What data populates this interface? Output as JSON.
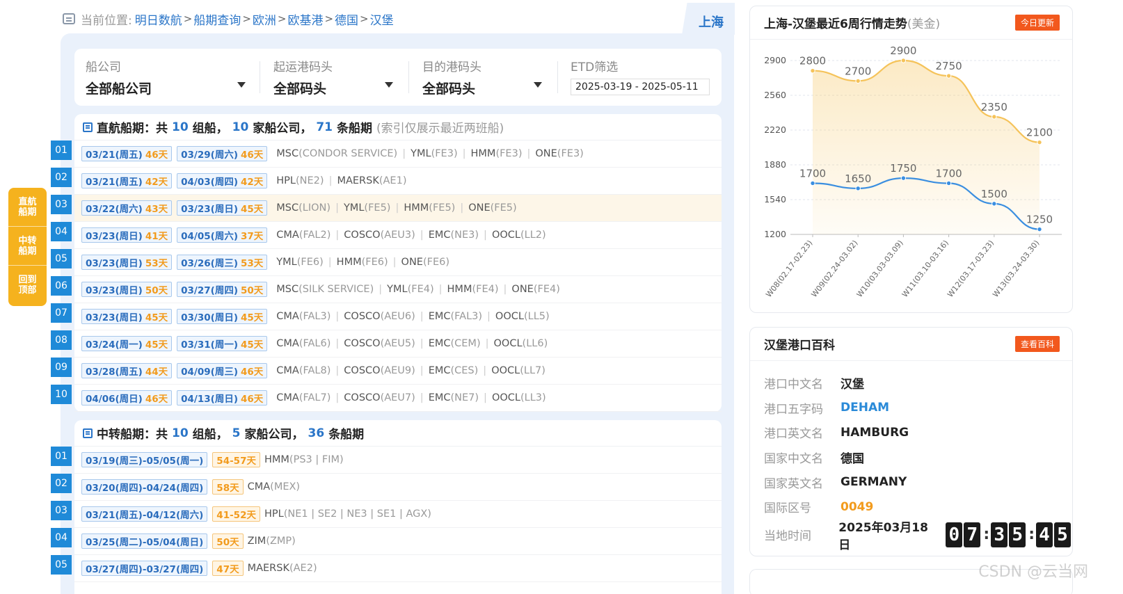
{
  "breadcrumb": {
    "prefix": "当前位置:",
    "items": [
      "明日数航",
      "船期查询",
      "欧洲",
      "欧基港",
      "德国",
      "汉堡"
    ],
    "separator": ">"
  },
  "port_tab": "上海",
  "filters": {
    "carrier": {
      "label": "船公司",
      "value": "全部船公司"
    },
    "origin": {
      "label": "起运港码头",
      "value": "全部码头"
    },
    "destination": {
      "label": "目的港码头",
      "value": "全部码头"
    },
    "etd": {
      "label": "ETD筛选",
      "value": "2025-03-19 - 2025-05-11"
    }
  },
  "direct": {
    "title_prefix": "直航船期：共",
    "groups": "10",
    "groups_unit": "组船，",
    "carriers": "10",
    "carriers_unit": "家船公司，",
    "schedules": "71",
    "schedules_unit": "条船期",
    "note": "(索引仅展示最近两班船)",
    "rows": [
      {
        "num": "01",
        "d1": "03/21(周五)",
        "t1": "46天",
        "d2": "03/29(周六)",
        "t2": "46天",
        "carriers": [
          {
            "name": "MSC",
            "svc": "(CONDOR SERVICE)"
          },
          {
            "name": "YML",
            "svc": "(FE3)"
          },
          {
            "name": "HMM",
            "svc": "(FE3)"
          },
          {
            "name": "ONE",
            "svc": "(FE3)"
          }
        ]
      },
      {
        "num": "02",
        "d1": "03/21(周五)",
        "t1": "42天",
        "d2": "04/03(周四)",
        "t2": "42天",
        "carriers": [
          {
            "name": "HPL",
            "svc": "(NE2)"
          },
          {
            "name": "MAERSK",
            "svc": "(AE1)"
          }
        ]
      },
      {
        "num": "03",
        "d1": "03/22(周六)",
        "t1": "43天",
        "d2": "03/23(周日)",
        "t2": "45天",
        "carriers": [
          {
            "name": "MSC",
            "svc": "(LION)"
          },
          {
            "name": "YML",
            "svc": "(FE5)"
          },
          {
            "name": "HMM",
            "svc": "(FE5)"
          },
          {
            "name": "ONE",
            "svc": "(FE5)"
          }
        ]
      },
      {
        "num": "04",
        "d1": "03/23(周日)",
        "t1": "41天",
        "d2": "04/05(周六)",
        "t2": "37天",
        "carriers": [
          {
            "name": "CMA",
            "svc": "(FAL2)"
          },
          {
            "name": "COSCO",
            "svc": "(AEU3)"
          },
          {
            "name": "EMC",
            "svc": "(NE3)"
          },
          {
            "name": "OOCL",
            "svc": "(LL2)"
          }
        ]
      },
      {
        "num": "05",
        "d1": "03/23(周日)",
        "t1": "53天",
        "d2": "03/26(周三)",
        "t2": "53天",
        "carriers": [
          {
            "name": "YML",
            "svc": "(FE6)"
          },
          {
            "name": "HMM",
            "svc": "(FE6)"
          },
          {
            "name": "ONE",
            "svc": "(FE6)"
          }
        ]
      },
      {
        "num": "06",
        "d1": "03/23(周日)",
        "t1": "50天",
        "d2": "03/27(周四)",
        "t2": "50天",
        "carriers": [
          {
            "name": "MSC",
            "svc": "(SILK SERVICE)"
          },
          {
            "name": "YML",
            "svc": "(FE4)"
          },
          {
            "name": "HMM",
            "svc": "(FE4)"
          },
          {
            "name": "ONE",
            "svc": "(FE4)"
          }
        ]
      },
      {
        "num": "07",
        "d1": "03/23(周日)",
        "t1": "45天",
        "d2": "03/30(周日)",
        "t2": "45天",
        "carriers": [
          {
            "name": "CMA",
            "svc": "(FAL3)"
          },
          {
            "name": "COSCO",
            "svc": "(AEU6)"
          },
          {
            "name": "EMC",
            "svc": "(FAL3)"
          },
          {
            "name": "OOCL",
            "svc": "(LL5)"
          }
        ]
      },
      {
        "num": "08",
        "d1": "03/24(周一)",
        "t1": "45天",
        "d2": "03/31(周一)",
        "t2": "45天",
        "carriers": [
          {
            "name": "CMA",
            "svc": "(FAL6)"
          },
          {
            "name": "COSCO",
            "svc": "(AEU5)"
          },
          {
            "name": "EMC",
            "svc": "(CEM)"
          },
          {
            "name": "OOCL",
            "svc": "(LL6)"
          }
        ]
      },
      {
        "num": "09",
        "d1": "03/28(周五)",
        "t1": "44天",
        "d2": "04/09(周三)",
        "t2": "46天",
        "carriers": [
          {
            "name": "CMA",
            "svc": "(FAL8)"
          },
          {
            "name": "COSCO",
            "svc": "(AEU9)"
          },
          {
            "name": "EMC",
            "svc": "(CES)"
          },
          {
            "name": "OOCL",
            "svc": "(LL7)"
          }
        ]
      },
      {
        "num": "10",
        "d1": "04/06(周日)",
        "t1": "46天",
        "d2": "04/13(周日)",
        "t2": "46天",
        "carriers": [
          {
            "name": "CMA",
            "svc": "(FAL7)"
          },
          {
            "name": "COSCO",
            "svc": "(AEU7)"
          },
          {
            "name": "EMC",
            "svc": "(NE7)"
          },
          {
            "name": "OOCL",
            "svc": "(LL3)"
          }
        ]
      }
    ]
  },
  "transfer": {
    "title_prefix": "中转船期：共",
    "groups": "10",
    "groups_unit": "组船，",
    "carriers": "5",
    "carriers_unit": "家船公司，",
    "schedules": "36",
    "schedules_unit": "条船期",
    "rows": [
      {
        "num": "01",
        "range": "03/19(周三)-05/05(周一)",
        "days": "54-57天",
        "carrier": "HMM",
        "svc": "(PS3 | FIM)"
      },
      {
        "num": "02",
        "range": "03/20(周四)-04/24(周四)",
        "days": "58天",
        "carrier": "CMA",
        "svc": "(MEX)"
      },
      {
        "num": "03",
        "range": "03/21(周五)-04/12(周六)",
        "days": "41-52天",
        "carrier": "HPL",
        "svc": "(NE1 | SE2 | NE3 | SE1 | AGX)"
      },
      {
        "num": "04",
        "range": "03/25(周二)-05/04(周日)",
        "days": "50天",
        "carrier": "ZIM",
        "svc": "(ZMP)"
      },
      {
        "num": "05",
        "range": "03/27(周四)-03/27(周四)",
        "days": "47天",
        "carrier": "MAERSK",
        "svc": "(AE2)"
      }
    ]
  },
  "side_nav": [
    "直航船期",
    "中转船期",
    "回到顶部"
  ],
  "trend_card": {
    "title": "上海-汉堡最近6周行情走势",
    "unit": "(美金)",
    "badge": "今日更新"
  },
  "chart_data": {
    "type": "line",
    "categories": [
      "W08(02.17-02.23)",
      "W09(02.24-03.02)",
      "W10(03.03-03.09)",
      "W11(03.10-03.16)",
      "W12(03.17-03.23)",
      "W13(03.24-03.30)"
    ],
    "series": [
      {
        "values": [
          2800,
          2700,
          2900,
          2750,
          2350,
          2100
        ],
        "color": "#f5c35a",
        "area": true
      },
      {
        "values": [
          1700,
          1650,
          1750,
          1700,
          1500,
          1250
        ],
        "color": "#3a8ee0",
        "area": false
      }
    ],
    "yticks": [
      1200,
      1540,
      1880,
      2220,
      2560,
      2900
    ],
    "ylim": [
      1200,
      2900
    ],
    "grid": true
  },
  "port_card": {
    "title": "汉堡港口百科",
    "badge": "查看百科",
    "rows": [
      {
        "label": "港口中文名",
        "value": "汉堡",
        "style": ""
      },
      {
        "label": "港口五字码",
        "value": "DEHAM",
        "style": "blue"
      },
      {
        "label": "港口英文名",
        "value": "HAMBURG",
        "style": ""
      },
      {
        "label": "国家中文名",
        "value": "德国",
        "style": ""
      },
      {
        "label": "国家英文名",
        "value": "GERMANY",
        "style": ""
      },
      {
        "label": "国际区号",
        "value": "0049",
        "style": "orange"
      }
    ],
    "time_label": "当地时间",
    "time_date": "2025年03月18日",
    "clock": [
      "0",
      "7",
      "3",
      "5",
      "4",
      "5"
    ]
  },
  "watermark": "CSDN @云当网"
}
